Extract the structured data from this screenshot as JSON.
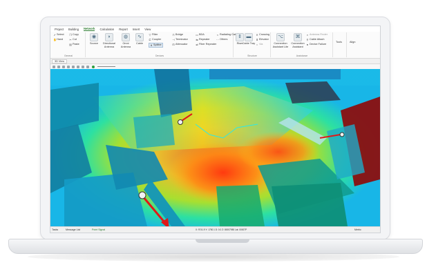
{
  "ribbon_tabs": [
    "Project",
    "Building",
    "Network",
    "Calculation",
    "Report",
    "Insert",
    "View"
  ],
  "active_tab": "Network",
  "groups": {
    "general": {
      "name": "General",
      "select": "Select",
      "hand": "Hand",
      "copy": "Copy",
      "cut": "Cut",
      "paste": "Paste"
    },
    "devices": {
      "name": "Devices",
      "source": "Source",
      "directional_antenna": "Directional Antenna",
      "omni_antenna": "Omni Antenna",
      "cable": "Cable",
      "filter": "Filter",
      "coupler": "Coupler",
      "splitter": "Splitter",
      "bridge": "Bridge",
      "terminator": "Terminator",
      "attenuator": "Attenuator",
      "bda": "BDA",
      "repeater": "Repeater",
      "fiber_repeater": "Fiber Repeater",
      "radiating_cable": "Radiating Cable",
      "others": "Others"
    },
    "structure": {
      "name": "Structure",
      "riser": "Riser",
      "cable_tray": "Cable Tray",
      "crossing": "Crossing",
      "elevator": "Elevator",
      "via": "Via"
    },
    "assistance": {
      "name": "Assistance",
      "connection_assistant_lite": "Connection Assistant Lite",
      "connection_assistant": "Connection Assistant",
      "antenna_finder": "Antenna Finder",
      "cable_attach": "Cable Attach",
      "device_failure": "Device Failure"
    },
    "tools": {
      "name": "Tools"
    },
    "align": {
      "name": "Align"
    }
  },
  "view": {
    "tab": "3D View"
  },
  "status_bar": {
    "tasks": "Tasks",
    "message_list": "Message List",
    "point_signal": "Point Signal",
    "coordinates": "X: 9741.9 Y: 1750.1 D: 0.0 Z: 80007980 Lat: 00007P",
    "right": "Metric"
  },
  "colors": {
    "accent_green": "#2e7d32",
    "arrow_red": "#e01818",
    "wall_dark": "#8b0f0f"
  }
}
